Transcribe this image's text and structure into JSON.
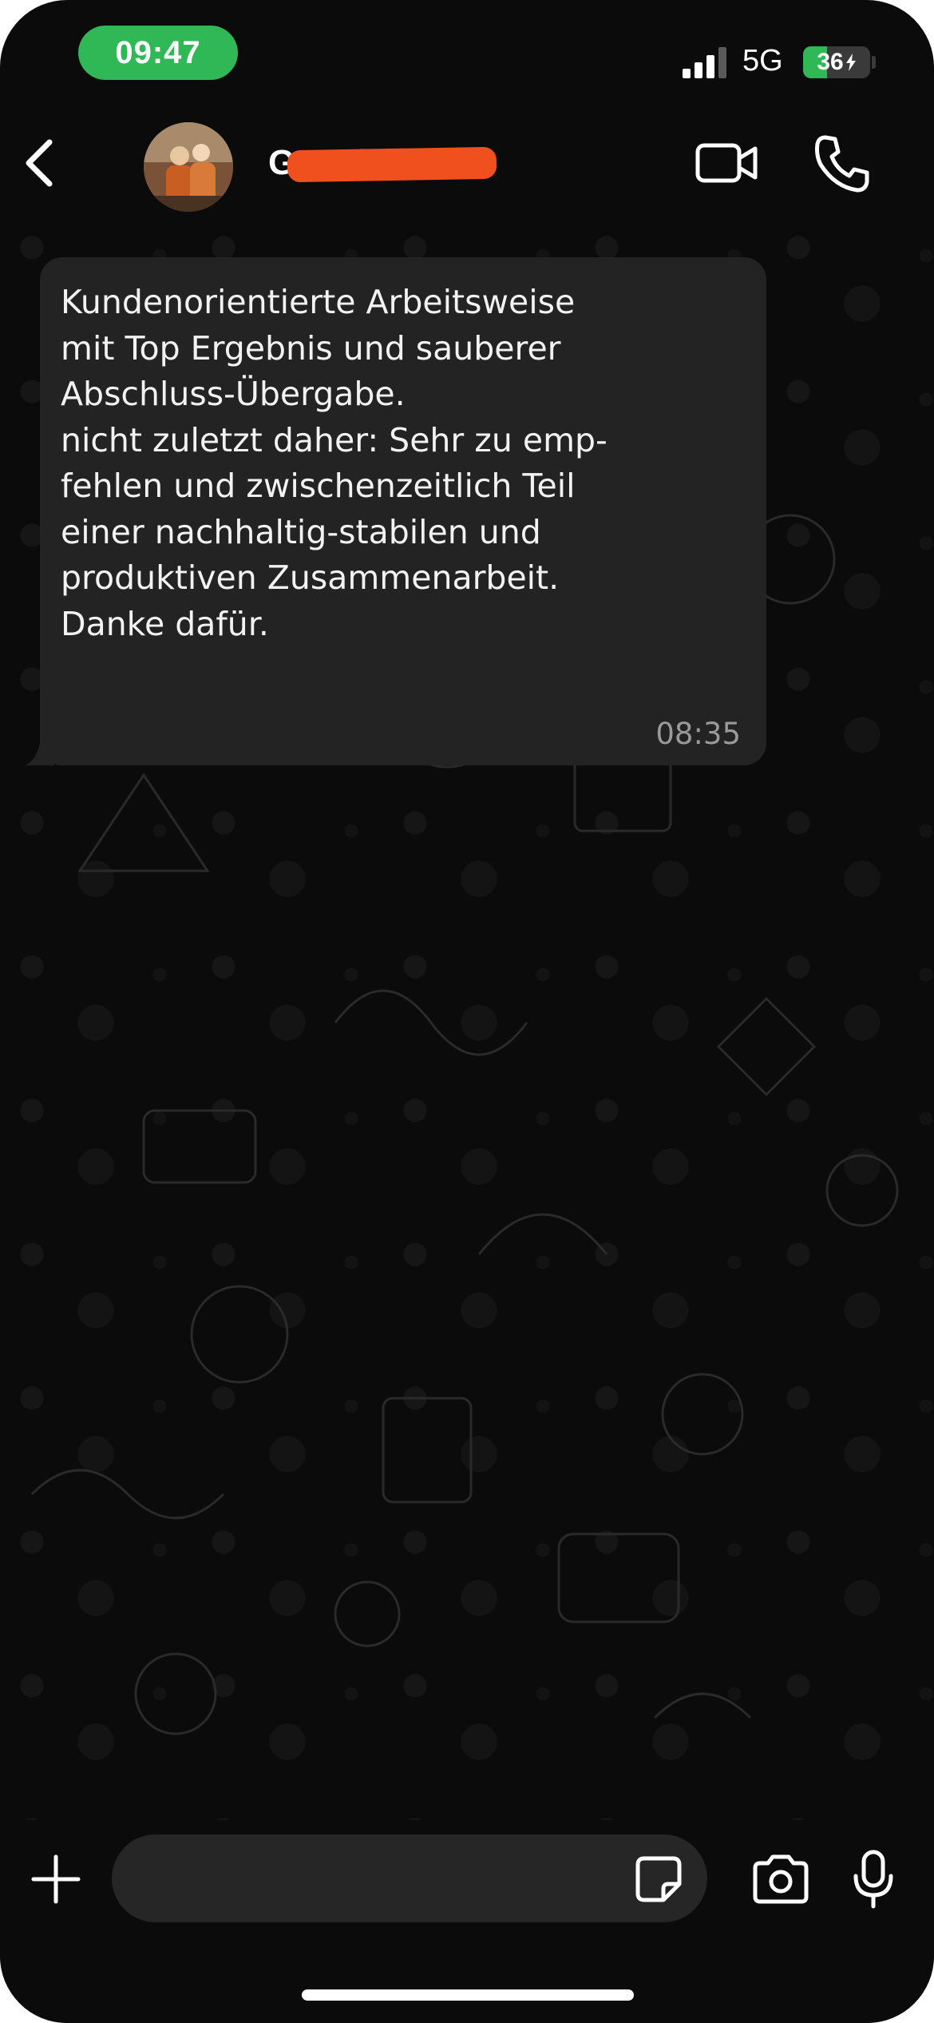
{
  "status_bar": {
    "time": "09:47",
    "network": "5G",
    "battery_percent": 36,
    "battery_label": "36",
    "signal_bars": 3,
    "colors": {
      "time_pill": "#2fb855",
      "battery_fill": "#2fb855"
    }
  },
  "header": {
    "contact_name_visible": "Gr           sel",
    "icons": [
      "chevron-left-icon",
      "video-camera-icon",
      "phone-icon"
    ]
  },
  "chat": {
    "messages": [
      {
        "text": "Kundenorientierte Arbeitsweise\nmit Top Ergebnis und sauberer\nAbschluss-Übergabe.\nnicht zuletzt daher: Sehr zu emp-\nfehlen und zwischenzeitlich Teil\neiner nachhaltig-stabilen und\nproduktiven Zusammenarbeit.\nDanke dafür.",
        "time": "08:35",
        "direction": "incoming"
      }
    ],
    "colors": {
      "bubble": "#232323",
      "background": "#0b0b0b"
    }
  },
  "input_bar": {
    "placeholder": "",
    "icons": [
      "plus-icon",
      "sticker-icon",
      "camera-icon",
      "microphone-icon"
    ]
  }
}
